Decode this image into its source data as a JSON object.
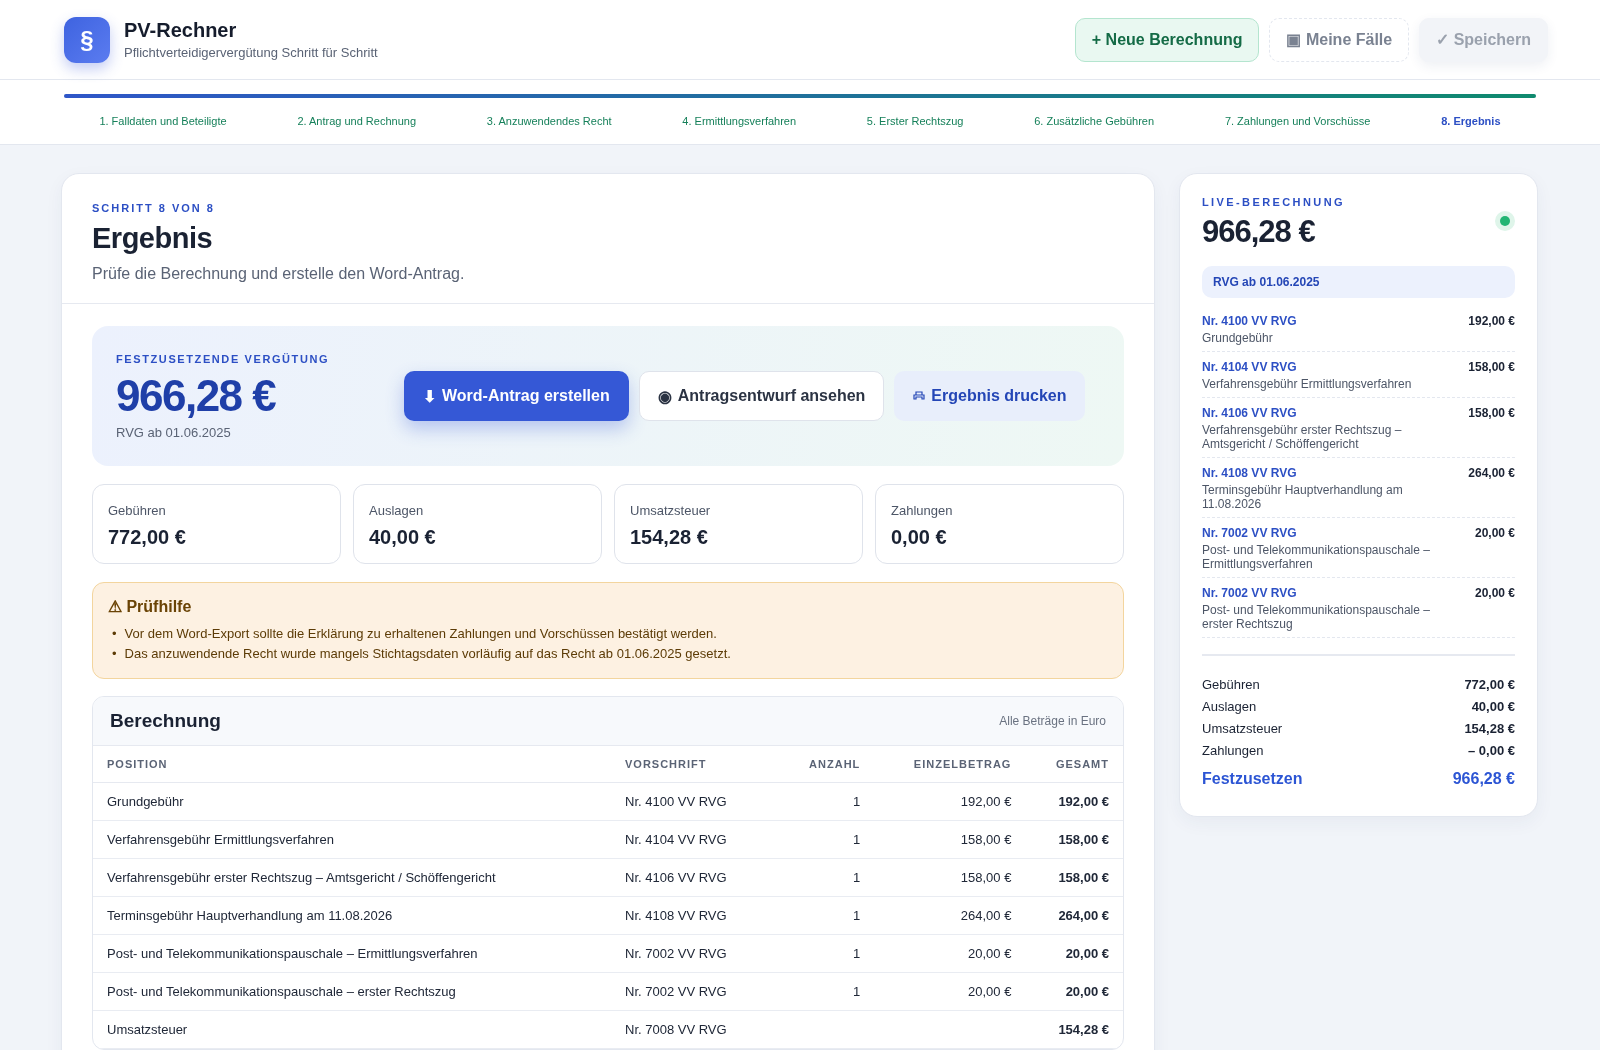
{
  "app": {
    "title": "PV-Rechner",
    "subtitle": "Pflichtverteidigervergütung Schritt für Schritt",
    "logo": "§"
  },
  "header_buttons": [
    {
      "kind": "primary",
      "icon": "+",
      "label": "Neue Berechnung",
      "disabled": false
    },
    {
      "kind": "dashed",
      "icon": "▣",
      "label": "Meine Fälle",
      "disabled": false
    },
    {
      "kind": "plain",
      "icon": "✓",
      "label": "Speichern",
      "disabled": true
    }
  ],
  "progress": {
    "level": 1
  },
  "steps": [
    {
      "label": "1. Falldaten und Beteiligte",
      "selected": false
    },
    {
      "label": "2. Antrag und Rechnung",
      "selected": false
    },
    {
      "label": "3. Anzuwendendes Recht",
      "selected": false
    },
    {
      "label": "4. Ermittlungsverfahren",
      "selected": false
    },
    {
      "label": "5. Erster Rechtszug",
      "selected": false
    },
    {
      "label": "6. Zusätzliche Gebühren",
      "selected": false
    },
    {
      "label": "7. Zahlungen und Vorschüsse",
      "selected": false
    },
    {
      "label": "8. Ergebnis",
      "selected": true
    }
  ],
  "page": {
    "eyebrow": "SCHRITT 8 VON 8",
    "title": "Ergebnis",
    "subtitle": "Prüfe die Berechnung und erstelle den Word-Antrag."
  },
  "hero": {
    "label": "FESTZUSETZENDE VERGÜTUNG",
    "amount": "966,28 €",
    "note": "RVG ab 01.06.2025",
    "actions": [
      {
        "kind": "primary",
        "icon": "⬇",
        "label": "Word-Antrag erstellen"
      },
      {
        "kind": "outline",
        "icon": "◉",
        "label": "Antragsentwurf ansehen"
      },
      {
        "kind": "soft",
        "label": "Ergebnis drucken"
      }
    ]
  },
  "stats": [
    {
      "label": "Gebühren",
      "value": "772,00 €"
    },
    {
      "label": "Auslagen",
      "value": "40,00 €"
    },
    {
      "label": "Umsatzsteuer",
      "value": "154,28 €"
    },
    {
      "label": "Zahlungen",
      "value": "0,00 €"
    }
  ],
  "notice": {
    "icon": "⚠",
    "title": "Prüfhilfe",
    "bullet": "•",
    "items": [
      "Vor dem Word-Export sollte die Erklärung zu erhaltenen Zahlungen und Vorschüssen bestätigt werden.",
      "Das anzuwendende Recht wurde mangels Stichtagsdaten vorläufig auf das Recht ab 01.06.2025 gesetzt."
    ]
  },
  "table": {
    "title": "Berechnung",
    "note": "Alle Beträge in Euro",
    "columns": [
      "POSITION",
      "VORSCHRIFT",
      "ANZAHL",
      "EINZELBETRAG",
      "GESAMT"
    ],
    "rows": [
      [
        "Grundgebühr",
        "Nr. 4100 VV RVG",
        "1",
        "192,00 €",
        "192,00 €"
      ],
      [
        "Verfahrensgebühr Ermittlungsverfahren",
        "Nr. 4104 VV RVG",
        "1",
        "158,00 €",
        "158,00 €"
      ],
      [
        "Verfahrensgebühr erster Rechtszug – Amtsgericht / Schöffengericht",
        "Nr. 4106 VV RVG",
        "1",
        "158,00 €",
        "158,00 €"
      ],
      [
        "Terminsgebühr Hauptverhandlung am 11.08.2026",
        "Nr. 4108 VV RVG",
        "1",
        "264,00 €",
        "264,00 €"
      ],
      [
        "Post- und Telekommunikationspauschale – Ermittlungsverfahren",
        "Nr. 7002 VV RVG",
        "1",
        "20,00 €",
        "20,00 €"
      ],
      [
        "Post- und Telekommunikationspauschale – erster Rechtszug",
        "Nr. 7002 VV RVG",
        "1",
        "20,00 €",
        "20,00 €"
      ],
      [
        "Umsatzsteuer",
        "Nr. 7008 VV RVG",
        "",
        "",
        "154,28 €"
      ]
    ]
  },
  "live": {
    "label": "LIVE-BERECHNUNG",
    "amount": "966,28 €",
    "status_on": true,
    "law": "RVG ab 01.06.2025",
    "items": [
      {
        "code": "Nr. 4100 VV RVG",
        "desc": "Grundgebühr",
        "amount": "192,00 €"
      },
      {
        "code": "Nr. 4104 VV RVG",
        "desc": "Verfahrensgebühr Ermittlungsverfahren",
        "amount": "158,00 €"
      },
      {
        "code": "Nr. 4106 VV RVG",
        "desc": "Verfahrensgebühr erster Rechtszug – Amtsgericht / Schöffengericht",
        "amount": "158,00 €"
      },
      {
        "code": "Nr. 4108 VV RVG",
        "desc": "Terminsgebühr Hauptverhandlung am 11.08.2026",
        "amount": "264,00 €"
      },
      {
        "code": "Nr. 7002 VV RVG",
        "desc": "Post- und Telekommunikationspauschale – Ermittlungsverfahren",
        "amount": "20,00 €"
      },
      {
        "code": "Nr. 7002 VV RVG",
        "desc": "Post- und Telekommunikationspauschale – erster Rechtszug",
        "amount": "20,00 €"
      }
    ],
    "totals": [
      {
        "label": "Gebühren",
        "value": "772,00 €"
      },
      {
        "label": "Auslagen",
        "value": "40,00 €"
      },
      {
        "label": "Umsatzsteuer",
        "value": "154,28 €"
      },
      {
        "label": "Zahlungen",
        "value": "– 0,00 €"
      }
    ],
    "final": {
      "label": "Festzusetzen",
      "value": "966,28 €"
    }
  }
}
